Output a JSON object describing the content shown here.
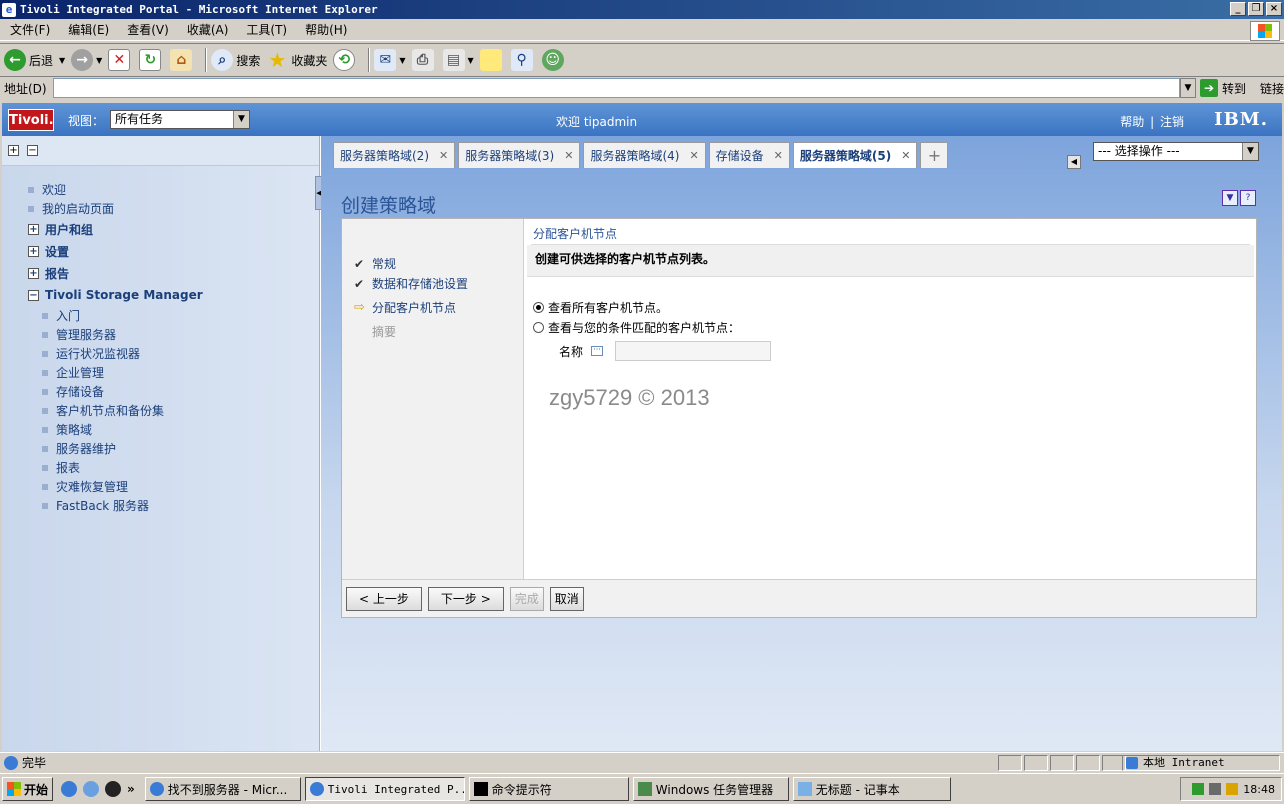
{
  "window": {
    "title": "Tivoli Integrated Portal - Microsoft Internet Explorer",
    "buttons": [
      "_",
      "❐",
      "×"
    ]
  },
  "menu": [
    "文件(F)",
    "编辑(E)",
    "查看(V)",
    "收藏(A)",
    "工具(T)",
    "帮助(H)"
  ],
  "toolbar": {
    "back": "后退",
    "search": "搜索",
    "favorites": "收藏夹"
  },
  "address": {
    "label": "地址(D)",
    "value": "",
    "go": "转到",
    "links": "链接"
  },
  "portal": {
    "logo": "Tivoli.",
    "view_label": "视图：",
    "view_value": "所有任务",
    "welcome": "欢迎  tipadmin",
    "help": "帮助",
    "logout": "注销",
    "brand": "IBM."
  },
  "nav": {
    "top_items": [
      "欢迎",
      "我的启动页面"
    ],
    "groups": [
      "用户和组",
      "设置",
      "报告"
    ],
    "tsm": "Tivoli Storage Manager",
    "tsm_items": [
      "入门",
      "管理服务器",
      "运行状况监视器",
      "企业管理",
      "存储设备",
      "客户机节点和备份集",
      "策略域",
      "服务器维护",
      "报表",
      "灾难恢复管理",
      "FastBack 服务器"
    ]
  },
  "tabs": [
    {
      "label": "服务器策略域(2)",
      "active": false
    },
    {
      "label": "服务器策略域(3)",
      "active": false
    },
    {
      "label": "服务器策略域(4)",
      "active": false
    },
    {
      "label": "存储设备",
      "active": false
    },
    {
      "label": "服务器策略域(5)",
      "active": true
    }
  ],
  "action_select": "--- 选择操作 ---",
  "panel": {
    "title": "创建策略域"
  },
  "wizard": {
    "steps": [
      {
        "label": "常规",
        "state": "done"
      },
      {
        "label": "数据和存储池设置",
        "state": "done"
      },
      {
        "label": "分配客户机节点",
        "state": "current"
      },
      {
        "label": "摘要",
        "state": "disabled"
      }
    ],
    "section_title": "分配客户机节点",
    "description": "创建可供选择的客户机节点列表。",
    "option_all": "查看所有客户机节点。",
    "option_match": "查看与您的条件匹配的客户机节点：",
    "selected_option": "all",
    "name_label": "名称",
    "name_value": "",
    "watermark": "zgy5729 © 2013",
    "buttons": {
      "back": "< 上一步",
      "next": "下一步 >",
      "finish": "完成",
      "cancel": "取消"
    }
  },
  "status": {
    "text": "完毕",
    "zone": "本地 Intranet"
  },
  "taskbar": {
    "start": "开始",
    "tasks": [
      {
        "label": "找不到服务器 - Micr...",
        "active": false
      },
      {
        "label": "Tivoli Integrated P...",
        "active": true
      },
      {
        "label": "命令提示符",
        "active": false
      },
      {
        "label": "Windows 任务管理器",
        "active": false
      },
      {
        "label": "无标题 - 记事本",
        "active": false
      }
    ],
    "clock": "18:48"
  },
  "colors": {
    "title_bar": "#0a246a",
    "portal_header": "#3a73c2",
    "tivoli_red": "#c2161a",
    "link_blue": "#1b3f7a"
  }
}
